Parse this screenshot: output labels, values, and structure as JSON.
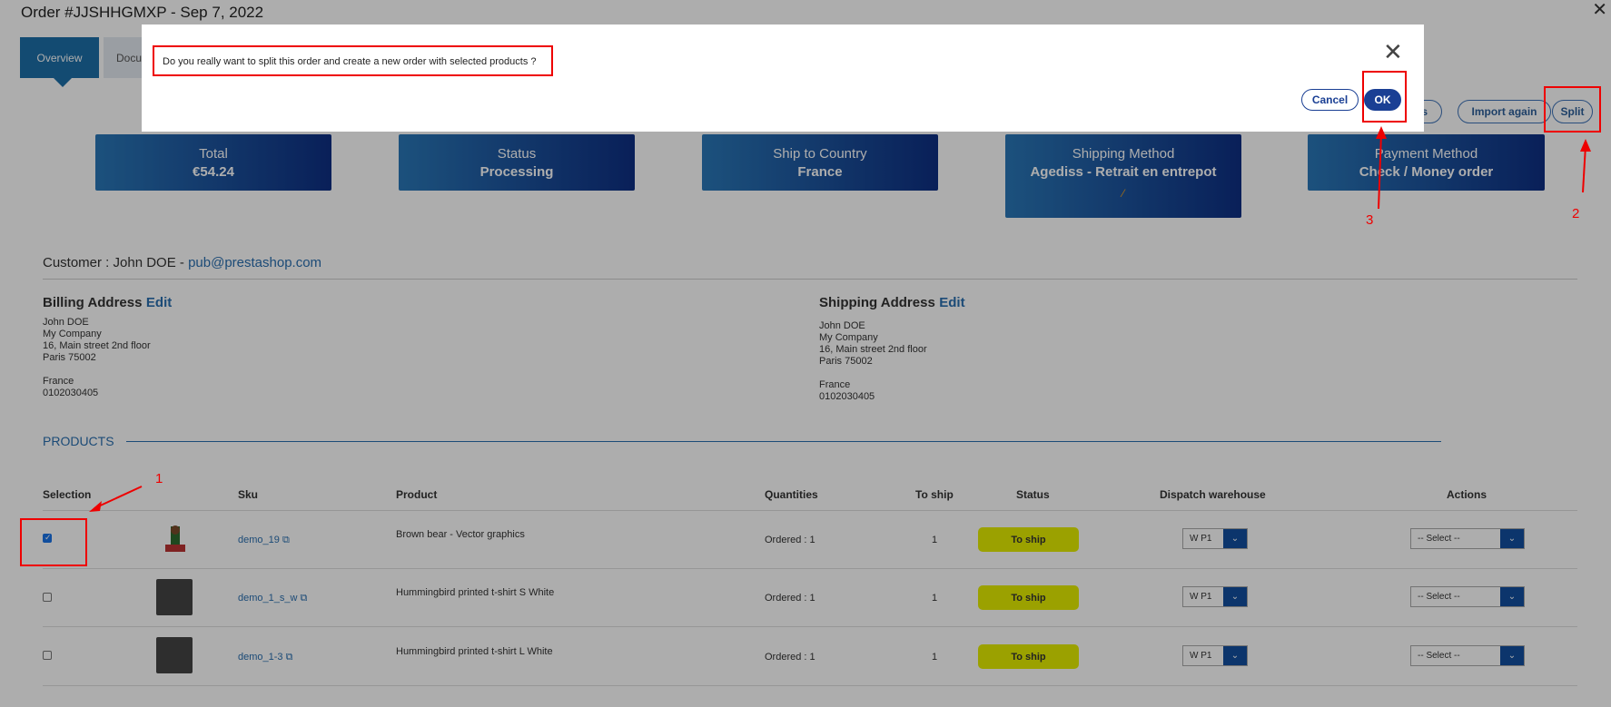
{
  "window": {
    "title": "Order #JJSHHGMXP - Sep 7, 2022"
  },
  "tabs": [
    {
      "label": "Overview"
    },
    {
      "label": "Docu"
    }
  ],
  "toolbar": {
    "details_label": "tails",
    "import_again_label": "Import again",
    "split_label": "Split"
  },
  "cards": [
    {
      "label": "Total",
      "value": "€54.24"
    },
    {
      "label": "Status",
      "value": "Processing"
    },
    {
      "label": "Ship to Country",
      "value": "France"
    },
    {
      "label": "Shipping Method",
      "value": "Agediss - Retrait en entrepot"
    },
    {
      "label": "Payment Method",
      "value": "Check / Money order"
    }
  ],
  "customer": {
    "prefix": "Customer : John DOE - ",
    "email": "pub@prestashop.com"
  },
  "billing": {
    "title": "Billing Address",
    "edit": "Edit",
    "lines": [
      "John DOE",
      "My Company",
      "16, Main street 2nd floor",
      "Paris 75002",
      "",
      "France",
      "0102030405"
    ]
  },
  "shipping": {
    "title": "Shipping Address",
    "edit": "Edit",
    "lines": [
      "John DOE",
      "My Company",
      "16, Main street 2nd floor",
      "Paris 75002",
      "",
      "France",
      "0102030405"
    ]
  },
  "products": {
    "heading": "PRODUCTS",
    "columns": [
      "Selection",
      "Sku",
      "Product",
      "Quantities",
      "To ship",
      "Status",
      "Dispatch warehouse",
      "Actions"
    ],
    "rows": [
      {
        "checked": true,
        "sku": "demo_19",
        "product": "Brown bear - Vector graphics",
        "quantities": "Ordered : 1",
        "to_ship": "1",
        "status": "To ship",
        "warehouse": "W P1",
        "action": "-- Select --"
      },
      {
        "checked": false,
        "sku": "demo_1_s_w",
        "product": "Hummingbird printed t-shirt S White",
        "quantities": "Ordered : 1",
        "to_ship": "1",
        "status": "To ship",
        "warehouse": "W P1",
        "action": "-- Select --"
      },
      {
        "checked": false,
        "sku": "demo_1-3",
        "product": "Hummingbird printed t-shirt L White",
        "quantities": "Ordered : 1",
        "to_ship": "1",
        "status": "To ship",
        "warehouse": "W P1",
        "action": "-- Select --"
      }
    ]
  },
  "modal": {
    "message": "Do you really want to split this order and create a new order with selected products ?",
    "cancel_label": "Cancel",
    "ok_label": "OK"
  },
  "annotations": {
    "step1": "1",
    "step2": "2",
    "step3": "3",
    "color": "#e00000"
  }
}
